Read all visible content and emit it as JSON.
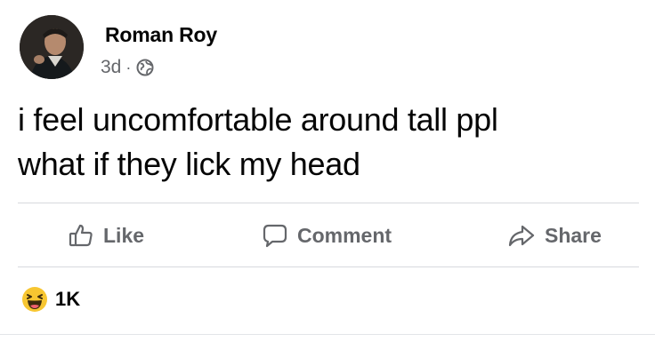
{
  "post": {
    "author": "Roman Roy",
    "time": "3d",
    "separator": "·",
    "privacy_icon": "globe-icon",
    "text_line_1": "i feel uncomfortable around tall ppl",
    "text_line_2": "what if they lick my head"
  },
  "actions": {
    "like_label": "Like",
    "comment_label": "Comment",
    "share_label": "Share"
  },
  "reactions": {
    "icon": "haha-emoji-icon",
    "count": "1K"
  },
  "colors": {
    "text_primary": "#050505",
    "text_secondary": "#65676b",
    "divider": "#d7d9dd",
    "haha_yellow": "#f7c631"
  }
}
